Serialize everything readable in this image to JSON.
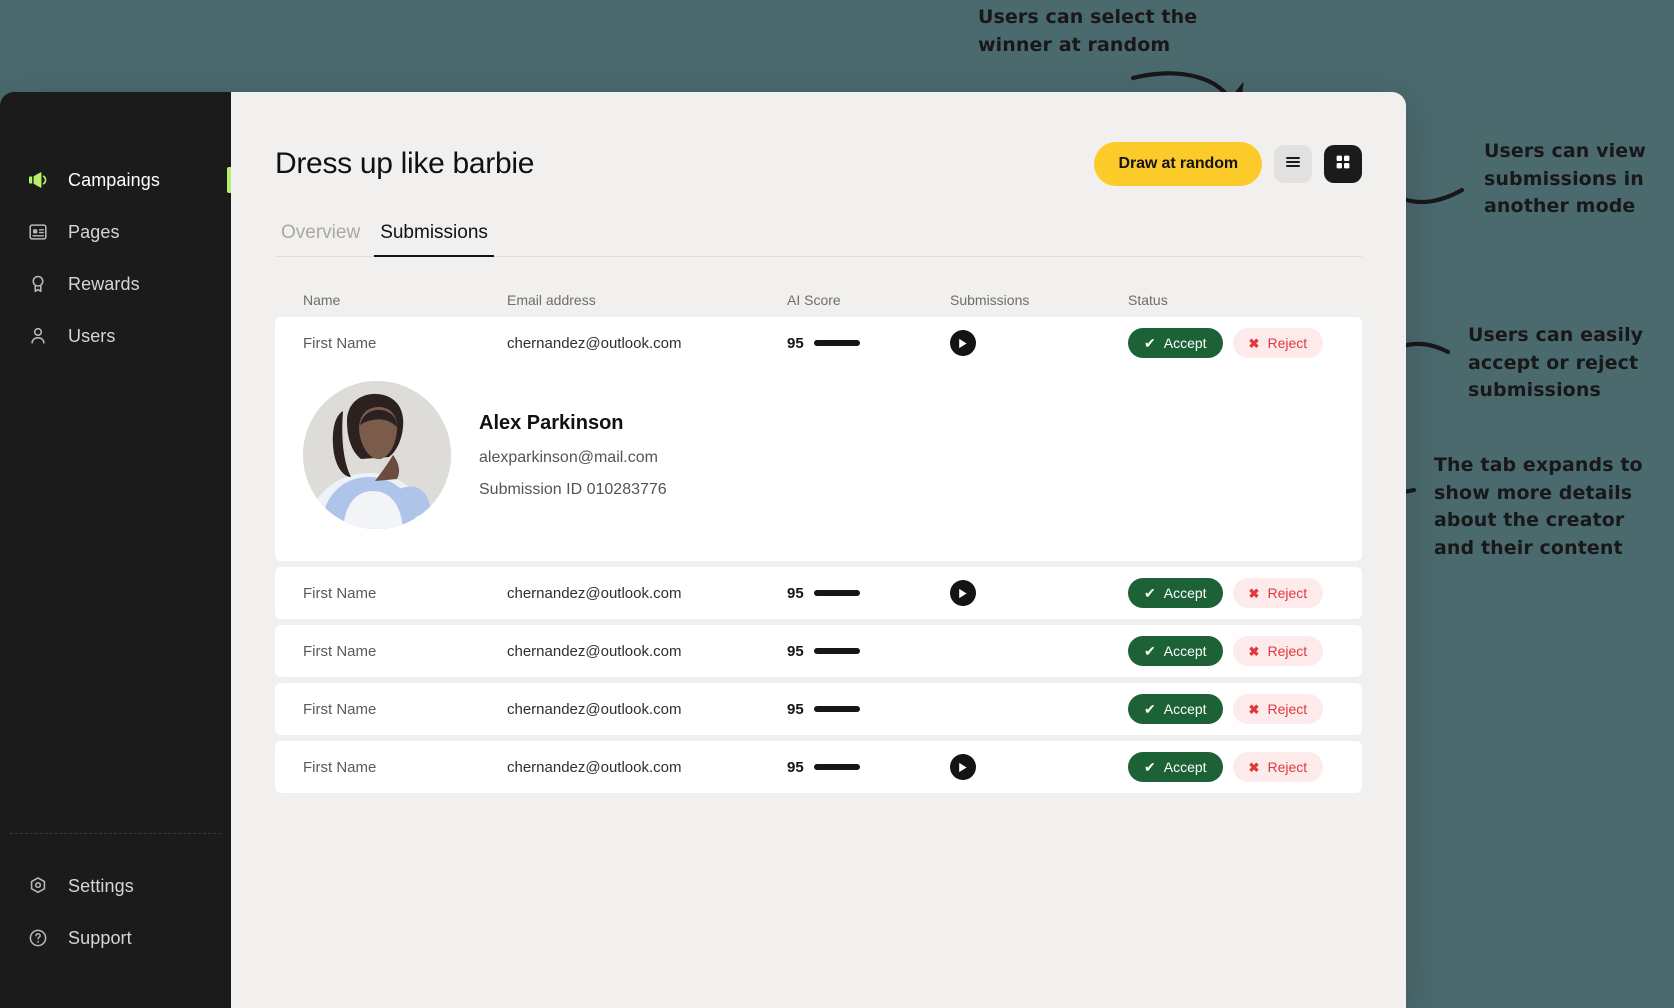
{
  "sidebar": {
    "items": [
      {
        "label": "Campaings",
        "icon": "megaphone-icon",
        "active": true
      },
      {
        "label": "Pages",
        "icon": "page-icon",
        "active": false
      },
      {
        "label": "Rewards",
        "icon": "award-icon",
        "active": false
      },
      {
        "label": "Users",
        "icon": "user-icon",
        "active": false
      }
    ],
    "bottom_items": [
      {
        "label": "Settings",
        "icon": "gear-icon"
      },
      {
        "label": "Support",
        "icon": "help-circle-icon"
      }
    ]
  },
  "header": {
    "title": "Dress up like barbie",
    "draw_button": "Draw at random",
    "view_list_icon": "list-view-icon",
    "view_grid_icon": "grid-view-icon"
  },
  "tabs": [
    {
      "label": "Overview",
      "active": false
    },
    {
      "label": "Submissions",
      "active": true
    }
  ],
  "table": {
    "columns": [
      "Name",
      "Email address",
      "AI Score",
      "Submissions",
      "Status"
    ],
    "accept_label": "Accept",
    "reject_label": "Reject",
    "accept_icon": "check-icon",
    "reject_icon": "x-icon",
    "play_icon": "play-icon",
    "rows": [
      {
        "name": "First Name",
        "email": "chernandez@outlook.com",
        "score": "95",
        "has_play": true,
        "expanded": true
      },
      {
        "name": "First Name",
        "email": "chernandez@outlook.com",
        "score": "95",
        "has_play": true,
        "expanded": false
      },
      {
        "name": "First Name",
        "email": "chernandez@outlook.com",
        "score": "95",
        "has_play": false,
        "expanded": false
      },
      {
        "name": "First Name",
        "email": "chernandez@outlook.com",
        "score": "95",
        "has_play": false,
        "expanded": false
      },
      {
        "name": "First Name",
        "email": "chernandez@outlook.com",
        "score": "95",
        "has_play": true,
        "expanded": false
      }
    ]
  },
  "detail": {
    "name": "Alex Parkinson",
    "email": "alexparkinson@mail.com",
    "submission_id": "Submission ID 010283776",
    "avatar": "creator-photo"
  },
  "annotations": [
    {
      "text": "Users can select the winner at random"
    },
    {
      "text": "Users can view submissions in another mode"
    },
    {
      "text": "Users can easily accept or reject submissions"
    },
    {
      "text": "The tab expands to show more details about the creator and their content"
    }
  ],
  "colors": {
    "background": "#4b6a6e",
    "sidebar": "#1b1b1b",
    "accent_green": "#b6f06a",
    "draw_yellow": "#fccb2a",
    "accept_green": "#1d6236",
    "reject_red": "#e0383c",
    "reject_bg": "#fdebeb"
  }
}
